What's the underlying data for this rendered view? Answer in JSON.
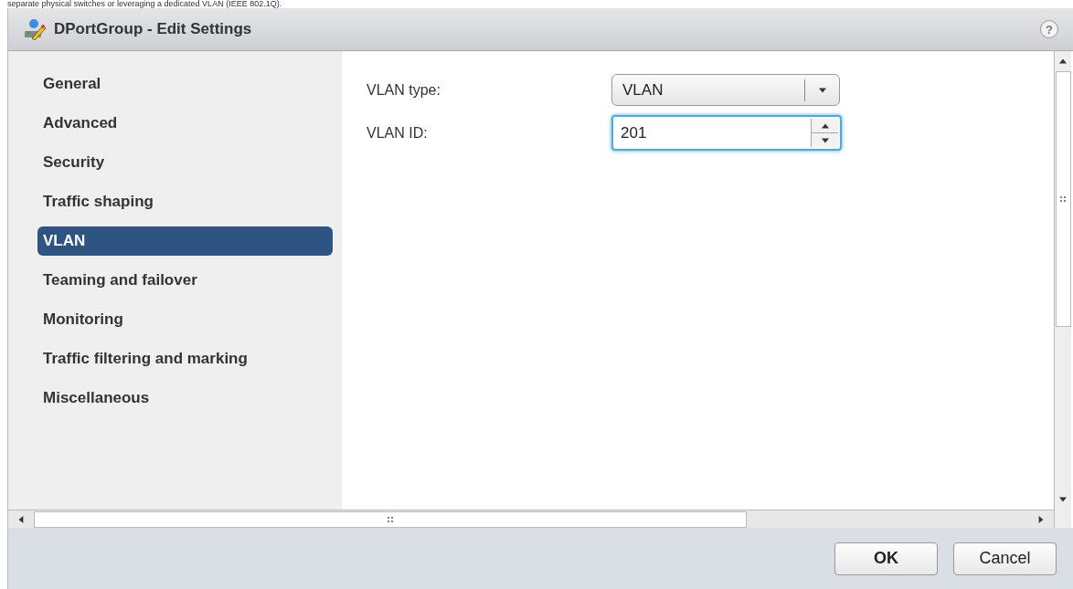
{
  "top_text": "separate physical switches or leveraging a dedicated VLAN (IEEE 802.1Q).",
  "window": {
    "title": "DPortGroup - Edit Settings",
    "help": "?"
  },
  "sidebar": {
    "items": [
      {
        "label": "General",
        "selected": false
      },
      {
        "label": "Advanced",
        "selected": false
      },
      {
        "label": "Security",
        "selected": false
      },
      {
        "label": "Traffic shaping",
        "selected": false
      },
      {
        "label": "VLAN",
        "selected": true
      },
      {
        "label": "Teaming and failover",
        "selected": false
      },
      {
        "label": "Monitoring",
        "selected": false
      },
      {
        "label": "Traffic filtering and marking",
        "selected": false
      },
      {
        "label": "Miscellaneous",
        "selected": false
      }
    ]
  },
  "fields": [
    {
      "kind": "select",
      "label": "VLAN type:",
      "value": "VLAN"
    },
    {
      "kind": "spinner",
      "label": "VLAN ID:",
      "value": "201",
      "focused": true
    }
  ],
  "buttons": [
    {
      "label": "OK",
      "default": true
    },
    {
      "label": "Cancel",
      "default": false
    }
  ]
}
